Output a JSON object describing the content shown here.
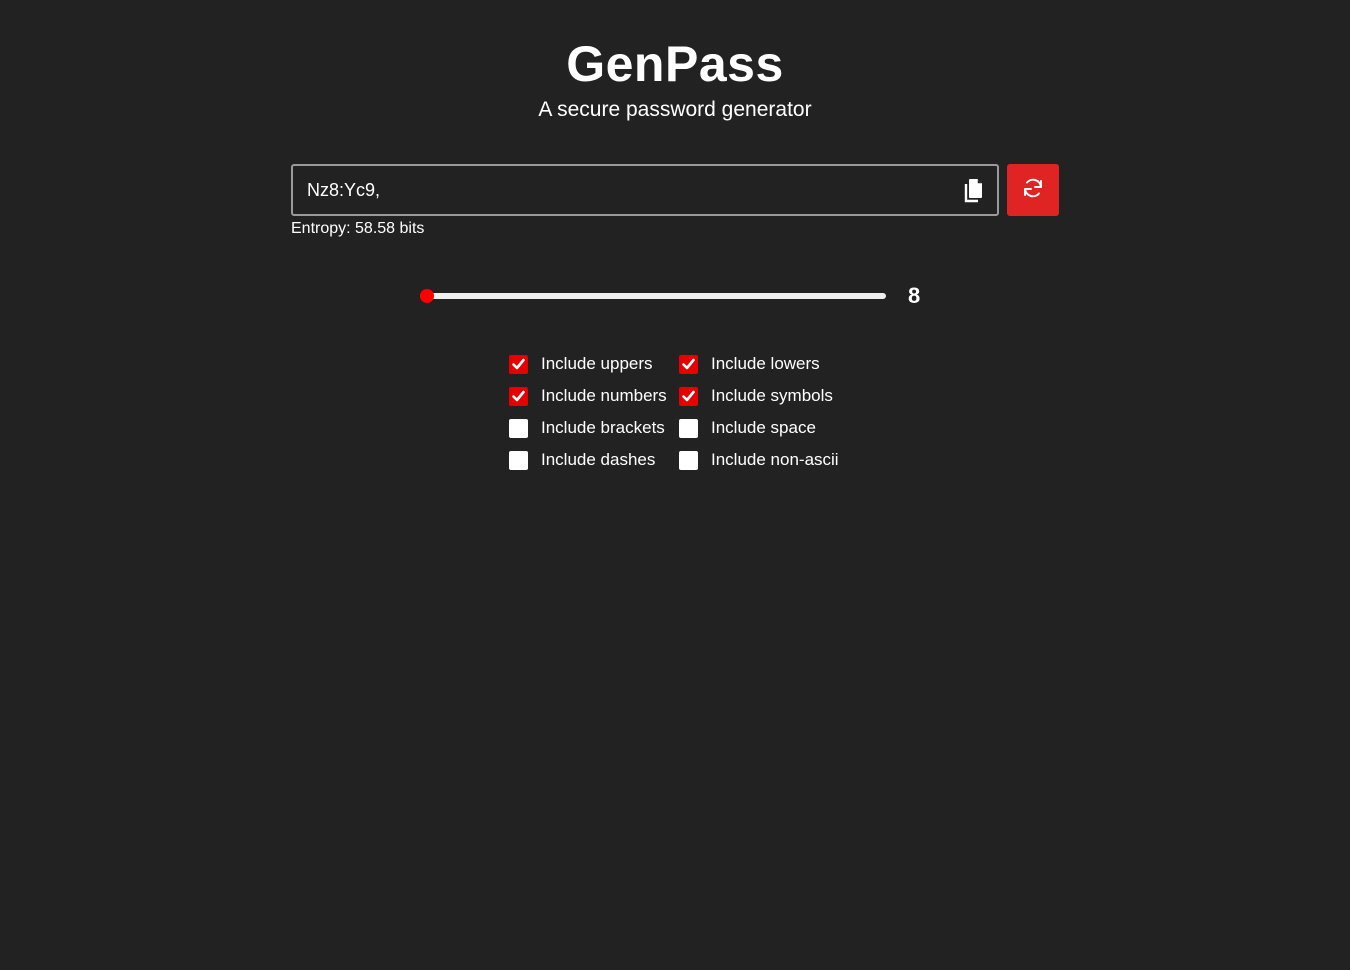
{
  "app": {
    "title": "GenPass",
    "subtitle": "A secure password generator"
  },
  "password": {
    "value": "Nz8:Yc9,",
    "copy_icon": "copy-icon",
    "refresh_icon": "refresh-icon"
  },
  "entropy": {
    "text": "Entropy: 58.58 bits"
  },
  "length": {
    "value": "8",
    "min": 8,
    "max": 128
  },
  "options": [
    {
      "label": "Include uppers",
      "checked": true
    },
    {
      "label": "Include lowers",
      "checked": true
    },
    {
      "label": "Include numbers",
      "checked": true
    },
    {
      "label": "Include symbols",
      "checked": true
    },
    {
      "label": "Include brackets",
      "checked": false
    },
    {
      "label": "Include space",
      "checked": false
    },
    {
      "label": "Include dashes",
      "checked": false
    },
    {
      "label": "Include non-ascii",
      "checked": false
    }
  ],
  "colors": {
    "background": "#222222",
    "accent": "#e02424",
    "checkbox_checked": "#e60000",
    "slider_thumb": "#ff0000"
  }
}
